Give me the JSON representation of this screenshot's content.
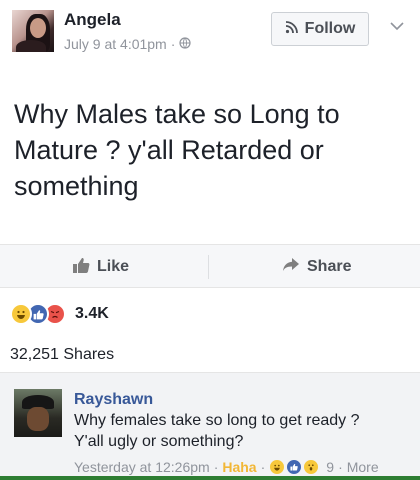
{
  "post": {
    "author": "Angela",
    "timestamp": "July 9 at 4:01pm",
    "separator": "·",
    "privacy_icon": "globe-icon",
    "follow_label": "Follow",
    "text": "Why Males take so Long to Mature ? y'all Retarded or something"
  },
  "actions": {
    "like_label": "Like",
    "share_label": "Share"
  },
  "reactions": {
    "types": [
      "haha",
      "like",
      "angry"
    ],
    "count": "3.4K"
  },
  "shares": {
    "label": "32,251 Shares"
  },
  "comment": {
    "author": "Rayshawn",
    "line1": "Why females take so long to get ready ?",
    "line2": "Y'all ugly or something?",
    "timestamp": "Yesterday at 12:26pm",
    "separator": "·",
    "reaction_label": "Haha",
    "reaction_count": "9",
    "more_label": "More"
  },
  "colors": {
    "link_blue": "#385898",
    "text": "#1d2129",
    "muted": "#90949c",
    "haha_yellow": "#f7c83b",
    "like_blue": "#4267b2",
    "angry_red": "#e9524a"
  }
}
